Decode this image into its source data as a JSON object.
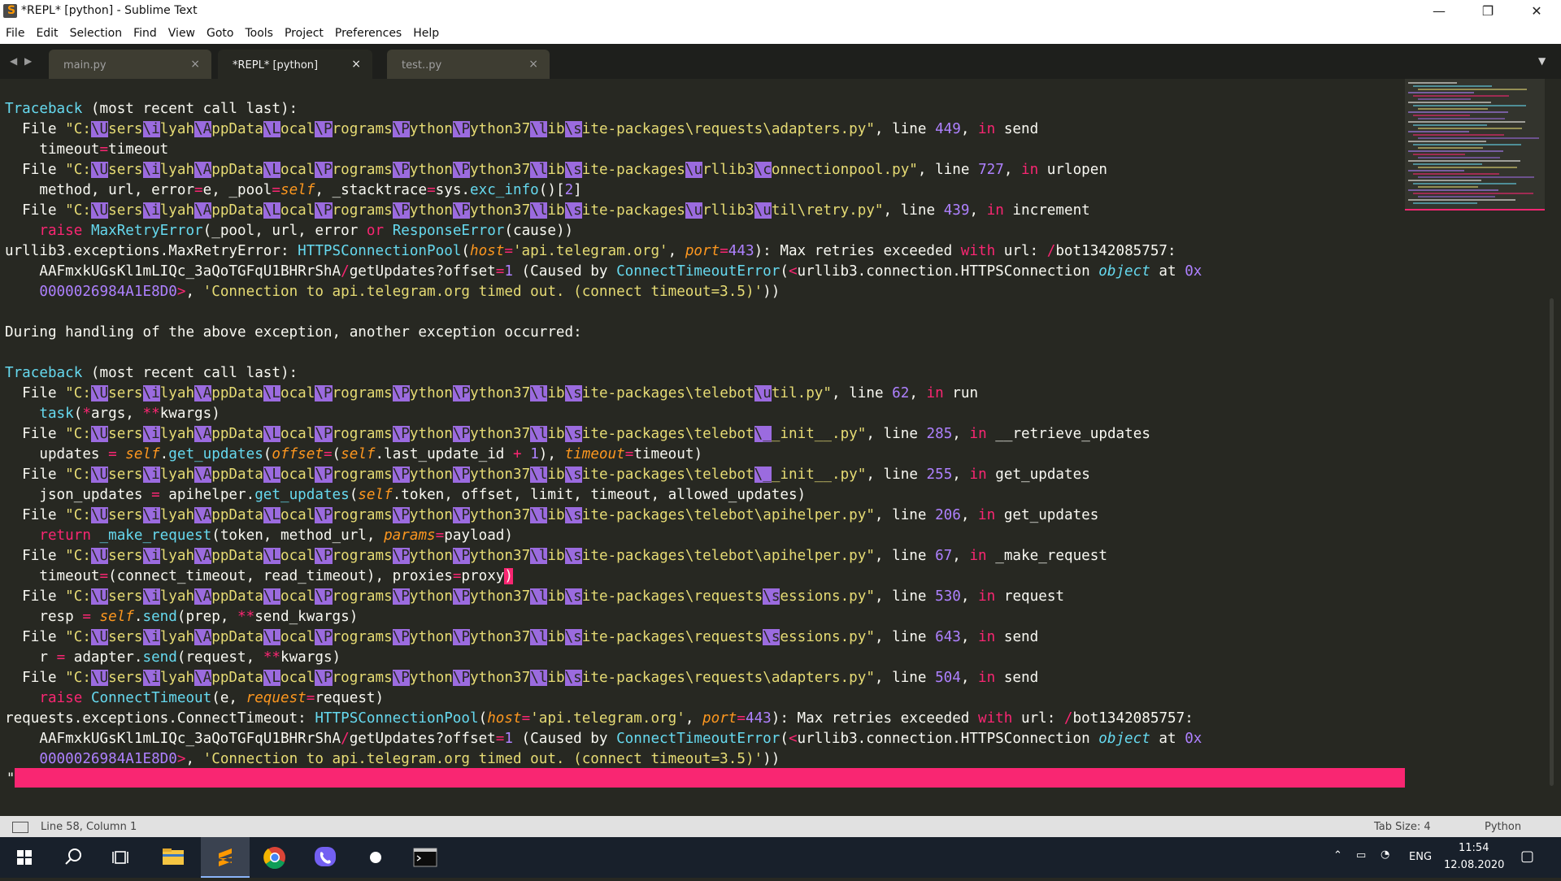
{
  "window": {
    "title": "*REPL* [python] - Sublime Text",
    "controls": {
      "minimize": "—",
      "maximize": "❐",
      "close": "✕"
    }
  },
  "menu": [
    "File",
    "Edit",
    "Selection",
    "Find",
    "View",
    "Goto",
    "Tools",
    "Project",
    "Preferences",
    "Help"
  ],
  "tabs": [
    {
      "label": "main.py",
      "active": false,
      "close": "×"
    },
    {
      "label": "*REPL* [python]",
      "active": true,
      "close": "×"
    },
    {
      "label": "test..py",
      "active": false,
      "close": "×"
    }
  ],
  "editor": {
    "cursor_char": "\""
  },
  "status": {
    "position": "Line 58, Column 1",
    "tab_size": "Tab Size: 4",
    "syntax": "Python"
  },
  "taskbar": {
    "language": "ENG",
    "time": "11:54",
    "date": "12.08.2020"
  },
  "colors": {
    "background": "#272822",
    "accent_pink": "#f92672",
    "keyword_blue": "#66d9ef",
    "string_yellow": "#e6db74",
    "number_purple": "#ae81ff",
    "highlight_purple": "#9b6bdf"
  }
}
